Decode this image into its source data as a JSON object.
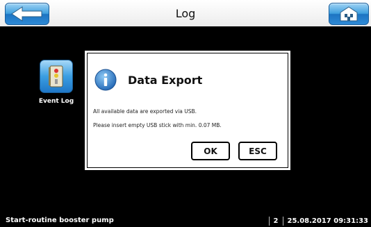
{
  "header": {
    "title": "Log",
    "back_icon": "arrow-left-icon",
    "home_icon": "home-icon"
  },
  "sidebar": {
    "event_log_label": "Event Log",
    "event_log_icon": "event-log-icon"
  },
  "dialog": {
    "title": "Data Export",
    "icon": "info-icon",
    "message_line1": "All available data are exported via USB.",
    "message_line2": "Please insert empty USB stick with min. 0.07 MB.",
    "ok_label": "OK",
    "esc_label": "ESC"
  },
  "footer": {
    "status_text": "Start-routine booster pump",
    "count": "2",
    "datetime": "25.08.2017 09:31:33"
  },
  "colors": {
    "accent_blue": "#2e8ad6",
    "background": "#000000"
  }
}
